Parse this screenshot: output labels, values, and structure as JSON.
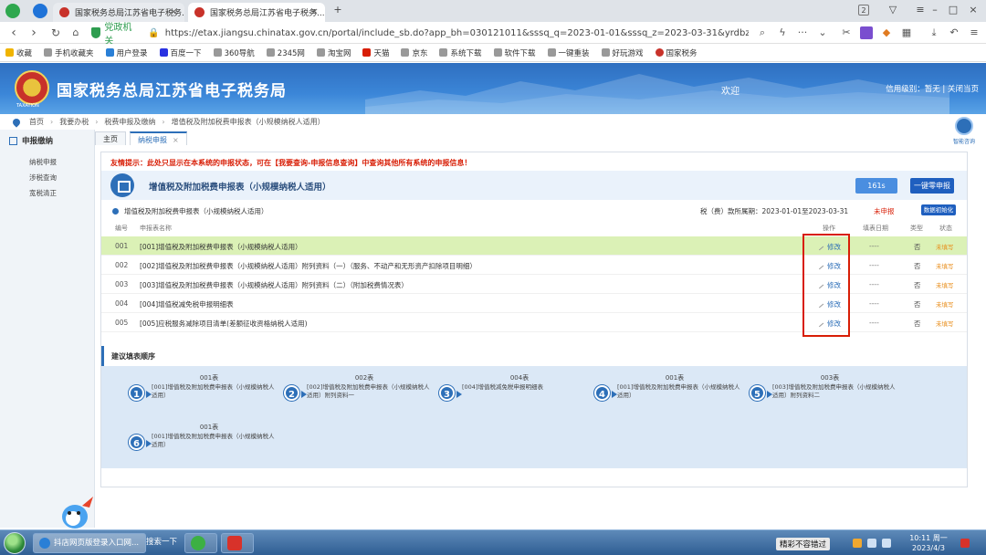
{
  "browser": {
    "tabs": [
      {
        "label": "国家税务总局江苏省电子税务...",
        "active": false
      },
      {
        "label": "国家税务总局江苏省电子税务...",
        "active": true
      }
    ],
    "url_badge": "党政机关",
    "url": "https://etax.jiangsu.chinatax.gov.cn/portal/include_sb.do?app_bh=030121011&sssq_q=2023-01-01&sssq_z=2023-03-31&yrdbz=must",
    "tab_count": "2",
    "bookmarks": [
      "收藏",
      "手机收藏夹",
      "用户登录",
      "百度一下",
      "360导航",
      "2345网",
      "淘宝网",
      "天猫",
      "京东",
      "系统下载",
      "软件下载",
      "一键重装",
      "好玩游戏",
      "国家税务"
    ]
  },
  "site": {
    "title": "国家税务总局江苏省电子税务局",
    "emblem_sub": "TAXATION",
    "welcome": "欢迎",
    "credit_label": "信用级别：暂无",
    "close_link": "关闭当页"
  },
  "breadcrumb": [
    "首页",
    "我要办税",
    "税费申报及缴纳",
    "增值税及附加税费申报表（小规模纳税人适用）"
  ],
  "sidebar": {
    "title": "申报缴纳",
    "items": [
      "纳税申报",
      "涉税查询",
      "宽税清正"
    ]
  },
  "page_tabs": [
    {
      "label": "主页",
      "active": false
    },
    {
      "label": "纳税申报",
      "active": true
    }
  ],
  "main": {
    "notice": "友情提示：此处只显示在本系统的申报状态，可在【我要查询-申报信息查询】中查询其他所有系统的申报信息！",
    "form_title": "增值税及附加税费申报表（小规模纳税人适用）",
    "timer": "161s",
    "zero_button": "一键零申报",
    "sub_title": "增值税及附加税费申报表（小规模纳税人适用）",
    "period": "税（费）款所属期：2023-01-01至2023-03-31",
    "period_status": "未申报",
    "init_button": "数据初始化",
    "columns": {
      "no": "编号",
      "name": "申报表名称",
      "op": "操作",
      "date": "填表日期",
      "type": "类型",
      "status": "状态"
    },
    "rows": [
      {
        "no": "001",
        "name": "[001]增值税及附加税费申报表（小规模纳税人适用）",
        "op": "修改",
        "date": "----",
        "type": "否",
        "status": "未填写"
      },
      {
        "no": "002",
        "name": "[002]增值税及附加税费申报表（小规模纳税人适用）附列资料（一）（服务、不动产和无形资产扣除项目明细）",
        "op": "修改",
        "date": "----",
        "type": "否",
        "status": "未填写"
      },
      {
        "no": "003",
        "name": "[003]增值税及附加税费申报表（小规模纳税人适用）附列资料（二）（附加税费情况表）",
        "op": "修改",
        "date": "----",
        "type": "否",
        "status": "未填写"
      },
      {
        "no": "004",
        "name": "[004]增值税减免税申报明细表",
        "op": "修改",
        "date": "----",
        "type": "否",
        "status": "未填写"
      },
      {
        "no": "005",
        "name": "[005]应税服务减除项目清单(差额征收资格纳税人适用)",
        "op": "修改",
        "date": "----",
        "type": "否",
        "status": "未填写"
      }
    ]
  },
  "order": {
    "title": "建议填表顺序",
    "steps": [
      {
        "num": "1",
        "label": "001表",
        "desc": "[001]增值税及附加税费申报表（小规模纳税人适用）"
      },
      {
        "num": "2",
        "label": "002表",
        "desc": "[002]增值税及附加税费申报表（小规模纳税人适用）附列资料一"
      },
      {
        "num": "3",
        "label": "004表",
        "desc": "[004]增值税减免税申报明细表"
      },
      {
        "num": "4",
        "label": "001表",
        "desc": "[001]增值税及附加税费申报表（小规模纳税人适用）"
      },
      {
        "num": "5",
        "label": "003表",
        "desc": "[003]增值税及附加税费申报表（小规模纳税人适用）附列资料二"
      },
      {
        "num": "6",
        "label": "001表",
        "desc": "[001]增值税及附加税费申报表（小规模纳税人适用）"
      }
    ]
  },
  "helper": {
    "label": "智能咨询"
  },
  "taskbar": {
    "tasks": [
      "抖店网页版登录入口网...",
      "搜索一下"
    ],
    "tray_text": "精彩不容错过",
    "clock_time": "10:11 周一",
    "clock_date": "2023/4/3"
  },
  "colors": {
    "accent": "#2d6fb8",
    "header": "#3b86d8",
    "warning": "#d81e06",
    "highlight_row": "#dbf1b6"
  }
}
